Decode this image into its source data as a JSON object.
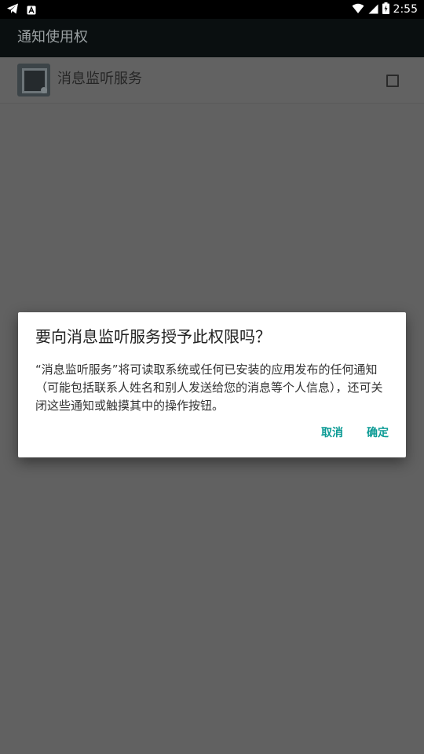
{
  "status_bar": {
    "time": "2:55",
    "icons": [
      "telegram-icon",
      "keyboard-a-icon",
      "wifi-icon",
      "signal-icon",
      "battery-charging-icon"
    ]
  },
  "toolbar": {
    "title": "通知使用权"
  },
  "list": {
    "items": [
      {
        "label": "消息监听服务",
        "checked": false
      }
    ]
  },
  "dialog": {
    "title": "要向消息监听服务授予此权限吗？",
    "message": "“消息监听服务”将可读取系统或任何已安装的应用发布的任何通知（可能包括联系人姓名和别人发送给您的消息等个人信息），还可关闭这些通知或触摸其中的操作按钮。",
    "cancel_label": "取消",
    "ok_label": "确定"
  },
  "colors": {
    "accent": "#0a9a94",
    "scrim": "#616161",
    "toolbar": "#0a0f10"
  }
}
